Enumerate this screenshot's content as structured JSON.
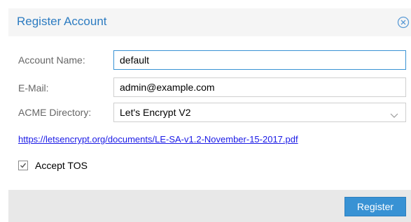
{
  "dialog": {
    "title": "Register Account",
    "close_icon": "close-circle-icon",
    "accent_color": "#2d7cc1"
  },
  "form": {
    "account_name": {
      "label": "Account Name:",
      "value": "default"
    },
    "email": {
      "label": "E-Mail:",
      "value": "admin@example.com"
    },
    "acme_directory": {
      "label": "ACME Directory:",
      "selected": "Let's Encrypt V2"
    },
    "tos_link": "https://letsencrypt.org/documents/LE-SA-v1.2-November-15-2017.pdf",
    "accept_tos": {
      "label": "Accept TOS",
      "checked": true
    }
  },
  "footer": {
    "register_label": "Register",
    "button_color": "#3892d4"
  }
}
